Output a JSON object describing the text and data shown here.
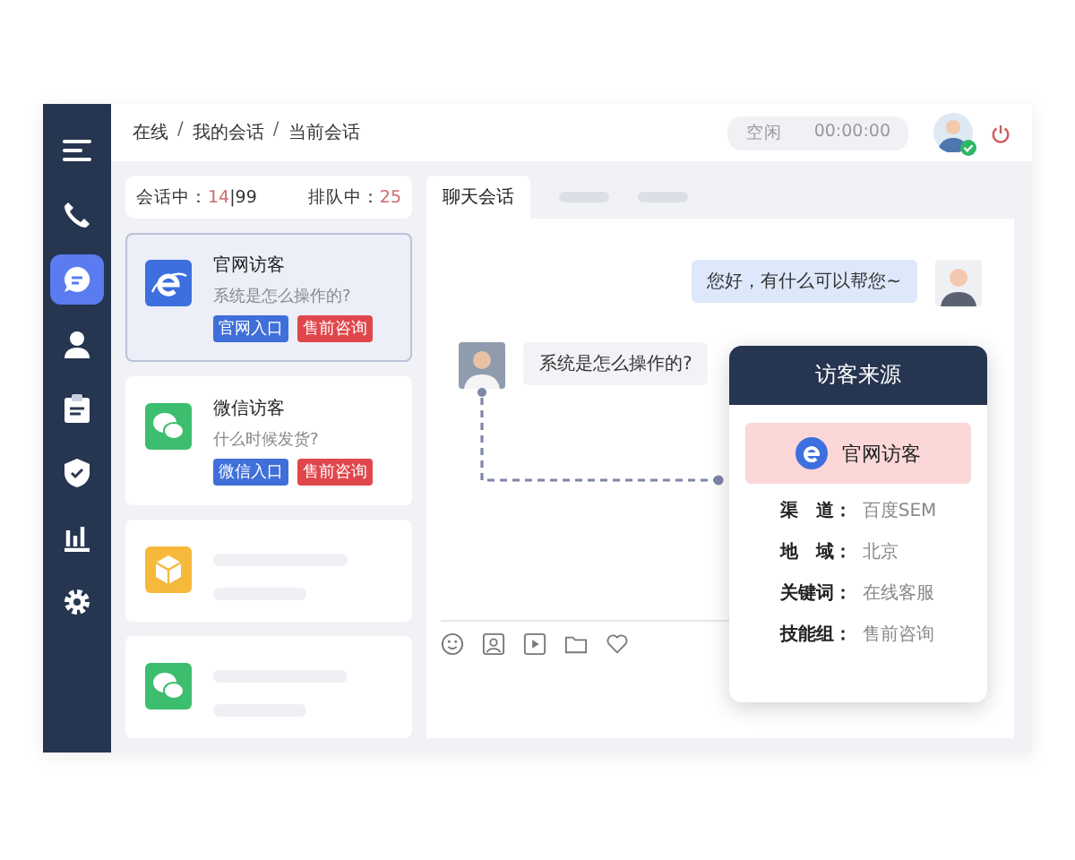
{
  "sidebar": {
    "items": [
      {
        "kind": "menu",
        "selected": false
      },
      {
        "kind": "phone",
        "selected": false
      },
      {
        "kind": "chat",
        "selected": true
      },
      {
        "kind": "person",
        "selected": false
      },
      {
        "kind": "clipboard",
        "selected": false
      },
      {
        "kind": "shield",
        "selected": false
      },
      {
        "kind": "chart",
        "selected": false
      },
      {
        "kind": "settings",
        "selected": false
      }
    ]
  },
  "breadcrumb": [
    "在线",
    "我的会话",
    "当前会话"
  ],
  "breadcrumb_separator": "/",
  "status": {
    "label": "空闲",
    "timer": "00:00:00",
    "online": true
  },
  "stats": {
    "active_label": "会话中：",
    "active": "14",
    "divider": "|",
    "capacity": "99",
    "queue_label": "排队中：",
    "queue": "25"
  },
  "conversations": [
    {
      "kind": "website",
      "selected": true,
      "title": "官网访客",
      "preview": "系统是怎么操作的?",
      "tags": [
        {
          "text": "官网入口",
          "color": "#3f6fd8"
        },
        {
          "text": "售前咨询",
          "color": "#e0474c"
        }
      ]
    },
    {
      "kind": "wechat",
      "selected": false,
      "title": "微信访客",
      "preview": "什么时候发货?",
      "tags": [
        {
          "text": "微信入口",
          "color": "#3f6fd8"
        },
        {
          "text": "售前咨询",
          "color": "#e0474c"
        }
      ]
    },
    {
      "kind": "package",
      "selected": false
    },
    {
      "kind": "wechat",
      "selected": false
    }
  ],
  "chat_tabs": [
    {
      "label": "聊天会话",
      "selected": true
    },
    {
      "selected": false
    },
    {
      "selected": false
    }
  ],
  "messages": [
    {
      "kind": "agent",
      "text": "您好，有什么可以帮您~"
    },
    {
      "kind": "visitor",
      "text": "系统是怎么操作的?"
    }
  ],
  "visitor_source": {
    "title": "访客来源",
    "source": "官网访客",
    "fields": [
      {
        "label": "渠　道：",
        "value": "百度SEM"
      },
      {
        "label": "地　域：",
        "value": "北京"
      },
      {
        "label": "关键词：",
        "value": "在线客服"
      },
      {
        "label": "技能组：",
        "value": "售前咨询"
      }
    ]
  }
}
